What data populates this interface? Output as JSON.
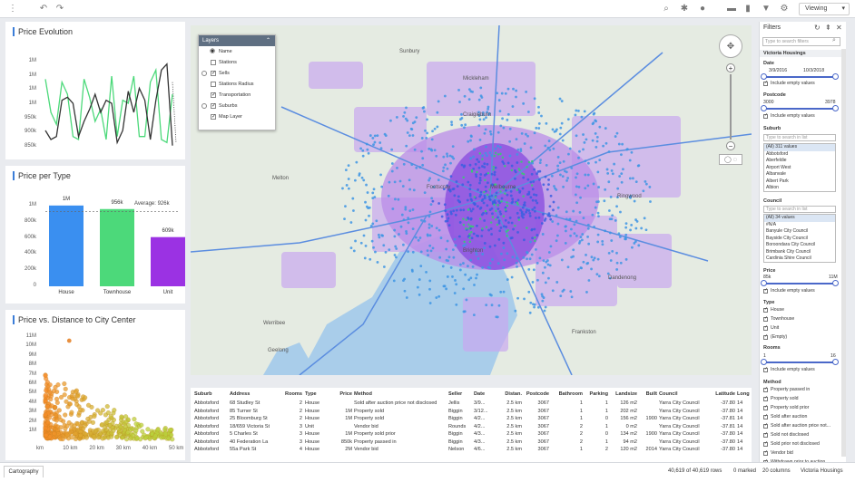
{
  "topbar": {
    "viewing_label": "Viewing"
  },
  "price_evolution": {
    "title": "Price Evolution",
    "yticks": [
      "1M",
      "1M",
      "1M",
      "1M",
      "950k",
      "900k",
      "850k"
    ]
  },
  "price_per_type": {
    "title": "Price per Type",
    "yticks": [
      "1M",
      "800k",
      "600k",
      "400k",
      "200k",
      "0"
    ],
    "average_label": "Average: 926k"
  },
  "price_vs_distance": {
    "title": "Price vs. Distance to City Center",
    "yticks": [
      "11M",
      "10M",
      "9M",
      "8M",
      "7M",
      "6M",
      "5M",
      "4M",
      "3M",
      "2M",
      "1M"
    ],
    "xticks": [
      "km",
      "10 km",
      "20 km",
      "30 km",
      "40 km",
      "50 km"
    ]
  },
  "chart_data": [
    {
      "type": "bar",
      "title": "Price per Type",
      "categories": [
        "House",
        "Townhouse",
        "Unit"
      ],
      "values": [
        1000000,
        956000,
        609000
      ],
      "value_labels": [
        "1M",
        "956k",
        "609k"
      ],
      "ylim": [
        0,
        1200000
      ],
      "average": 926000,
      "colors": [
        "#3a8ff0",
        "#4cd97a",
        "#9b32e3"
      ]
    },
    {
      "type": "scatter",
      "title": "Price vs. Distance to City Center",
      "xlabel": "",
      "ylabel": "",
      "xlim": [
        0,
        52
      ],
      "ylim": [
        0,
        11500000
      ]
    },
    {
      "type": "line",
      "title": "Price Evolution",
      "series": [
        {
          "color": "#4cd97a",
          "values": [
            1070000,
            960000,
            920000,
            1060000,
            1020000,
            880000,
            870000,
            1070000,
            1010000,
            930000,
            970000,
            870000,
            1080000,
            880000,
            1000000,
            990000,
            1080000,
            880000,
            880000,
            1060000,
            1100000,
            870000,
            860000,
            1020000
          ]
        },
        {
          "color": "#333333",
          "values": [
            900000,
            870000,
            880000,
            1000000,
            1010000,
            990000,
            880000,
            930000,
            970000,
            1020000,
            960000,
            1000000,
            990000,
            860000,
            900000,
            1030000,
            960000,
            1040000,
            1000000,
            870000,
            1000000,
            1100000,
            1120000,
            850000
          ]
        }
      ]
    }
  ],
  "layers": {
    "header": "Layers",
    "items": [
      {
        "label": "Name",
        "checked": null
      },
      {
        "label": "Stations",
        "checked": false
      },
      {
        "label": "Sells",
        "checked": true
      },
      {
        "label": "Stations Radius",
        "checked": false
      },
      {
        "label": "Transportation",
        "checked": true
      },
      {
        "label": "Suburbs",
        "checked": true
      },
      {
        "label": "Map Layer",
        "checked": true
      }
    ]
  },
  "map": {
    "place_labels": [
      "Sunbury",
      "Mickleham",
      "Craigieburn",
      "Melton",
      "Melbourne",
      "Werribee",
      "Ringwood",
      "Geelong",
      "Frankston",
      "Dandenong",
      "Brighton",
      "Footscray"
    ]
  },
  "table": {
    "headers": [
      "Suburb",
      "Address",
      "Rooms",
      "Type",
      "Price",
      "Method",
      "Seller",
      "Date",
      "Distan.",
      "Postcode",
      "Bathroom",
      "Parking",
      "Landsize",
      "Built",
      "Council",
      "Latitude",
      "Long"
    ],
    "rows": [
      [
        "Abbotsford",
        "68 Studley St",
        "2",
        "House",
        "",
        "Sold after auction price not disclosed",
        "Jellis",
        "3/9...",
        "2.5 km",
        "3067",
        "1",
        "1",
        "126 m2",
        "",
        "Yarra City Council",
        "-37.80",
        "14"
      ],
      [
        "Abbotsford",
        "85 Turner St",
        "2",
        "House",
        "1M",
        "Property sold",
        "Biggin",
        "3/12...",
        "2.5 km",
        "3067",
        "1",
        "1",
        "202 m2",
        "",
        "Yarra City Council",
        "-37.80",
        "14"
      ],
      [
        "Abbotsford",
        "25 Bloomburg St",
        "2",
        "House",
        "1M",
        "Property sold",
        "Biggin",
        "4/2...",
        "2.5 km",
        "3067",
        "1",
        "0",
        "156 m2",
        "1900",
        "Yarra City Council",
        "-37.81",
        "14"
      ],
      [
        "Abbotsford",
        "18/659 Victoria St",
        "3",
        "Unit",
        "",
        "Vendor bid",
        "Rounds",
        "4/2...",
        "2.5 km",
        "3067",
        "2",
        "1",
        "0 m2",
        "",
        "Yarra City Council",
        "-37.81",
        "14"
      ],
      [
        "Abbotsford",
        "5 Charles St",
        "3",
        "House",
        "1M",
        "Property sold prior",
        "Biggin",
        "4/3...",
        "2.5 km",
        "3067",
        "2",
        "0",
        "134 m2",
        "1900",
        "Yarra City Council",
        "-37.80",
        "14"
      ],
      [
        "Abbotsford",
        "40 Federation La",
        "3",
        "House",
        "850k",
        "Property passed in",
        "Biggin",
        "4/3...",
        "2.5 km",
        "3067",
        "2",
        "1",
        "94 m2",
        "",
        "Yarra City Council",
        "-37.80",
        "14"
      ],
      [
        "Abbotsford",
        "55a Park St",
        "4",
        "House",
        "2M",
        "Vendor bid",
        "Nelson",
        "4/6...",
        "2.5 km",
        "3067",
        "1",
        "2",
        "120 m2",
        "2014",
        "Yarra City Council",
        "-37.80",
        "14"
      ]
    ]
  },
  "status": {
    "tab": "Cartography",
    "rows": "40,619 of 40,619 rows",
    "marked": "0 marked",
    "columns": "20 columns",
    "dataset": "Victoria Housings"
  },
  "filters": {
    "title": "Filters",
    "search_placeholder": "Type to search filters",
    "dataset": "Victoria Housings",
    "date_label": "Date",
    "date_from": "3/9/2016",
    "date_to": "10/3/2018",
    "include_empty": "Include empty values",
    "postcode_label": "Postcode",
    "postcode_min": "3000",
    "postcode_max": "3978",
    "suburb_label": "Suburb",
    "list_search": "Type to search in list",
    "suburb_items": [
      "(All) 311 values",
      "Abbotsford",
      "Aberfeldie",
      "Airport West",
      "Albanvale",
      "Albert Park",
      "Albion"
    ],
    "council_label": "Council",
    "council_items": [
      "(All) 34 values",
      "#N/A",
      "Banyule City Council",
      "Bayside City Council",
      "Boroondara City Council",
      "Brimbank City Council",
      "Cardinia Shire Council"
    ],
    "price_label": "Price",
    "price_min": "85k",
    "price_max": "11M",
    "type_label": "Type",
    "type_items": [
      "House",
      "Townhouse",
      "Unit",
      "(Empty)"
    ],
    "rooms_label": "Rooms",
    "rooms_min": "1",
    "rooms_max": "16",
    "method_label": "Method",
    "method_items": [
      "Property passed in",
      "Property sold",
      "Property sold prior",
      "Sold after auction",
      "Sold after auction price not...",
      "Sold not disclosed",
      "Sold prior not disclosed",
      "Vendor bid",
      "Withdrawn prior to auction"
    ]
  }
}
